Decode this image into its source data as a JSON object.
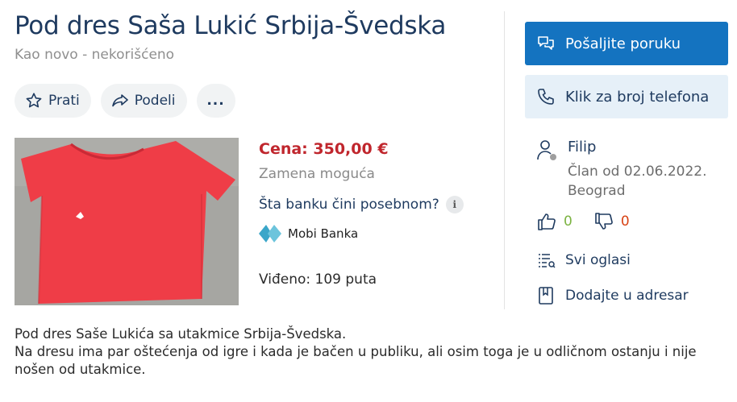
{
  "listing": {
    "title": "Pod dres Saša Lukić Srbija-Švedska",
    "condition": "Kao novo - nekorišćeno",
    "price": "Cena: 350,00 €",
    "exchange": "Zamena moguća",
    "bank_question": "Šta banku čini posebnom?",
    "bank_name": "Mobi Banka",
    "views": "Viđeno: 109 puta",
    "description": [
      "Pod dres Saše Lukića sa utakmice Srbija-Švedska.",
      "Na dresu ima par oštećenja od igre i kada je bačen u publiku, ali osim toga je u odličnom ostanju i nije nošen od utakmice."
    ]
  },
  "actions": {
    "follow": "Prati",
    "share": "Podeli",
    "more": "..."
  },
  "contact": {
    "message_button": "Pošaljite poruku",
    "phone_button": "Klik za broj telefona"
  },
  "seller": {
    "name": "Filip",
    "member_since": "Član od 02.06.2022.",
    "city": "Beograd",
    "positive": "0",
    "negative": "0",
    "all_ads": "Svi oglasi",
    "add_to_address_book": "Dodajte u adresar"
  },
  "colors": {
    "primary": "#1473c0",
    "title": "#1e3a5f",
    "price": "#c0262d",
    "positive": "#7cb342",
    "negative": "#d84315"
  }
}
